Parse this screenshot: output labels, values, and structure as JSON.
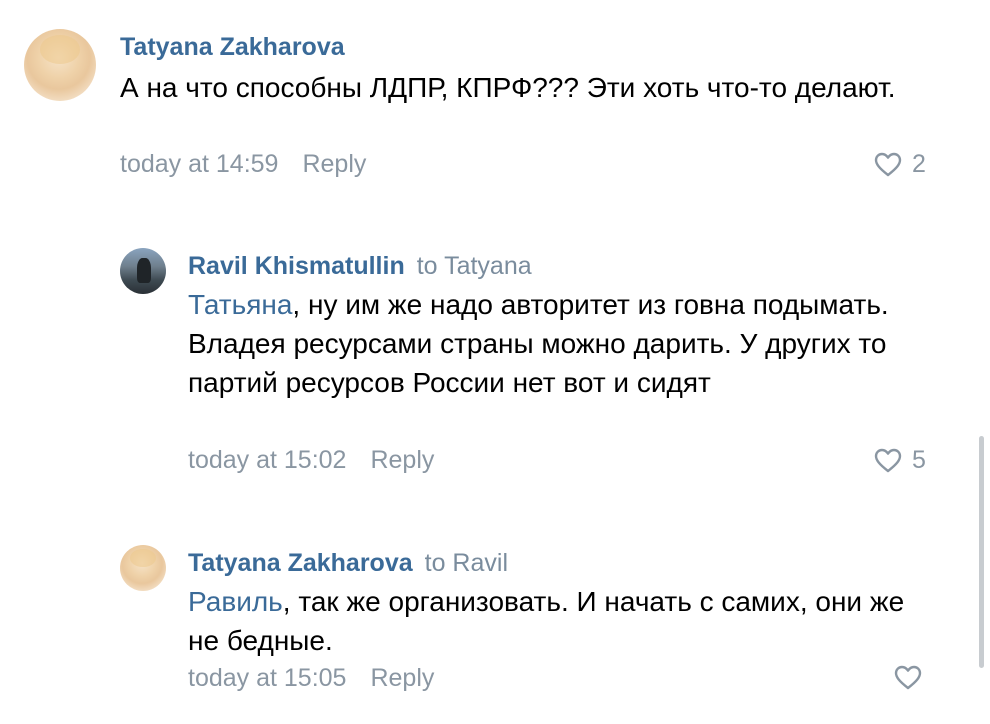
{
  "comments": [
    {
      "author": "Tatyana Zakharova",
      "to": "",
      "mention": "",
      "text": "А на что способны ЛДПР, КПРФ??? Эти хоть что-то делают.",
      "time": "today at 14:59",
      "reply_label": "Reply",
      "likes": "2"
    },
    {
      "author": "Ravil Khismatullin",
      "to": "to Tatyana",
      "mention": "Татьяна",
      "text": ", ну им же надо авторитет из говна подымать. Владея ресурсами страны можно дарить. У других то партий ресурсов России нет вот и сидят",
      "time": "today at 15:02",
      "reply_label": "Reply",
      "likes": "5"
    },
    {
      "author": "Tatyana Zakharova",
      "to": "to Ravil",
      "mention": "Равиль",
      "text": ", так же организовать. И начать с самих, они же не бедные.",
      "time": "today at 15:05",
      "reply_label": "Reply",
      "likes": ""
    }
  ],
  "icons": {
    "like": "heart-outline-icon",
    "avatar_1": "avatar",
    "avatar_2": "avatar",
    "avatar_3": "avatar"
  },
  "colors": {
    "author": "#3a6a98",
    "mention": "#3a6a98",
    "meta": "#8a96a2",
    "to_target": "#7a8c9d",
    "scrollbar": "#c8ccd0"
  }
}
